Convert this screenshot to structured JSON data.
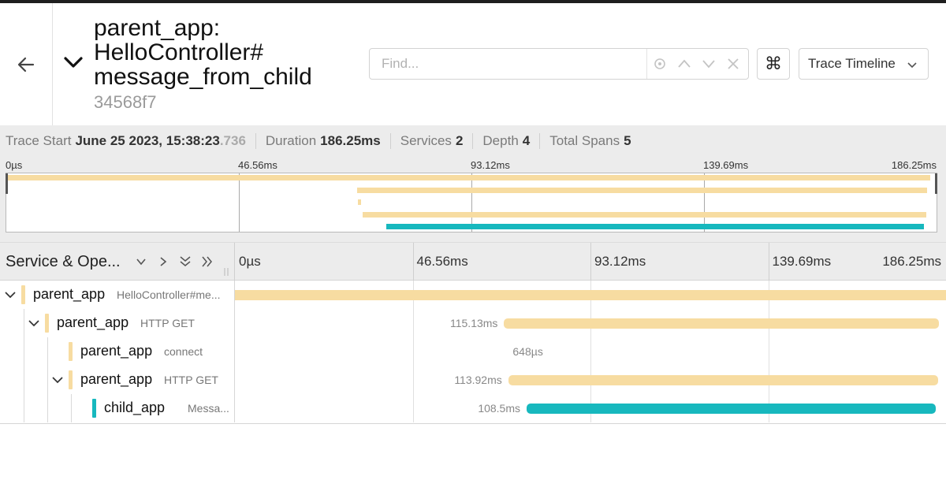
{
  "colors": {
    "parent_app": "#f7dca1",
    "child_app": "#17b8be"
  },
  "header": {
    "title": "parent_app: HelloController# message_from_child",
    "trace_id": "34568f7",
    "back_icon": "arrow-left-icon",
    "collapse_icon": "chevron-down-icon",
    "search_placeholder": "Find...",
    "search_value": "",
    "keyboard_shortcut_icon": "command-key-icon",
    "view_select": "Trace Timeline"
  },
  "summary": {
    "trace_start_label": "Trace Start",
    "trace_start_value": "June 25 2023, 15:38:23",
    "trace_start_ms": ".736",
    "duration_label": "Duration",
    "duration_value": "186.25ms",
    "services_label": "Services",
    "services_value": "2",
    "depth_label": "Depth",
    "depth_value": "4",
    "total_spans_label": "Total Spans",
    "total_spans_value": "5"
  },
  "ticks": [
    "0µs",
    "46.56ms",
    "93.12ms",
    "139.69ms",
    "186.25ms"
  ],
  "timeline_header": {
    "column_label": "Service & Operation",
    "column_label_display": "Service & Ope..."
  },
  "spans": [
    {
      "service": "parent_app",
      "operation": "HelloController#message_from_child",
      "operation_display": "HelloController#me...",
      "start_ms": 0,
      "duration_ms": 186.25,
      "duration_label": "",
      "depth": 0,
      "has_children": true
    },
    {
      "service": "parent_app",
      "operation": "HTTP GET",
      "operation_display": "HTTP GET",
      "start_ms": 70.5,
      "duration_ms": 115.13,
      "duration_label": "115.13ms",
      "depth": 1,
      "has_children": true
    },
    {
      "service": "parent_app",
      "operation": "connect",
      "operation_display": "connect",
      "start_ms": 70.7,
      "duration_ms": 0.648,
      "duration_label": "648µs",
      "depth": 2,
      "has_children": false
    },
    {
      "service": "parent_app",
      "operation": "HTTP GET",
      "operation_display": "HTTP GET",
      "start_ms": 71.6,
      "duration_ms": 113.92,
      "duration_label": "113.92ms",
      "depth": 2,
      "has_children": true
    },
    {
      "service": "child_app",
      "operation": "Message",
      "operation_display": "Messa...",
      "start_ms": 76.4,
      "duration_ms": 108.5,
      "duration_label": "108.5ms",
      "depth": 3,
      "has_children": false
    }
  ]
}
